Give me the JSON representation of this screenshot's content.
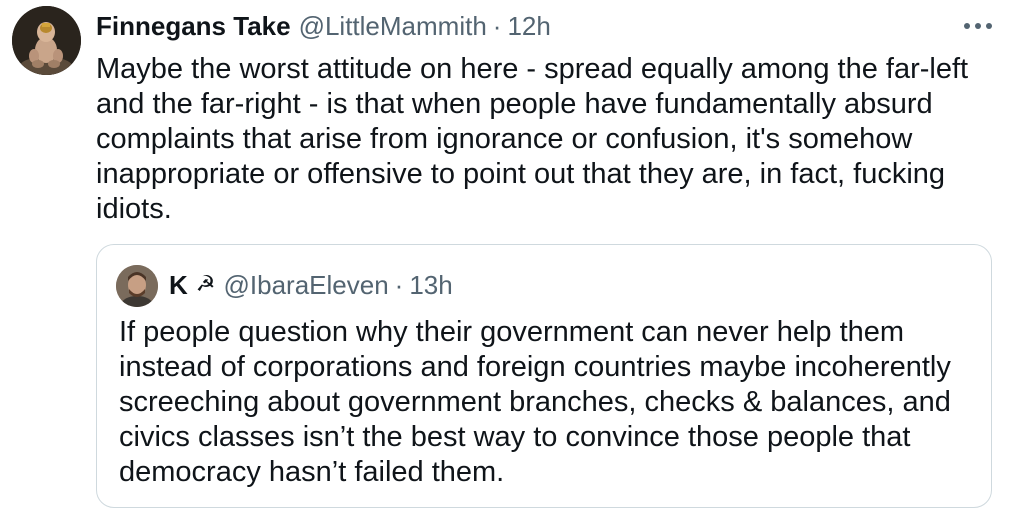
{
  "tweet": {
    "author_name": "Finnegans Take",
    "author_handle": "@LittleMammith",
    "separator": "·",
    "time": "12h",
    "text": "Maybe the worst attitude on here - spread equally among the far-left and the far-right - is that when people have fundamentally absurd complaints that arise from ignorance or confusion, it's somehow inappropriate or offensive to point out that they are, in fact, fucking idiots.",
    "more_icon": "more-horizontal-icon"
  },
  "quoted": {
    "author_name": "K",
    "author_emoji": "☭",
    "author_handle": "@IbaraEleven",
    "separator": "·",
    "time": "13h",
    "text": "If people question why their government can never help them instead of corporations and foreign countries maybe incoherently screeching about government branches, checks & balances, and civics classes isn’t the best way to convince those people that democracy hasn’t failed them."
  },
  "colors": {
    "text": "#0f1419",
    "secondary": "#536471",
    "border": "#cfd9de"
  }
}
